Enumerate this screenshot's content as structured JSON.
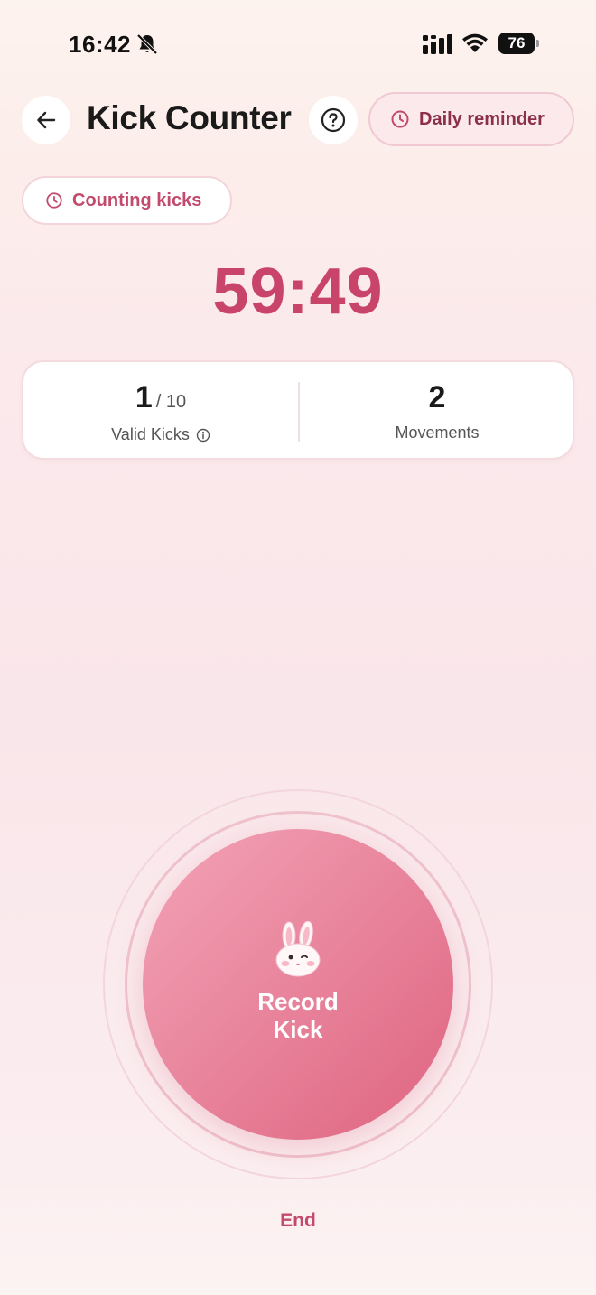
{
  "status_bar": {
    "time": "16:42",
    "battery_percent": "76",
    "icons": [
      "bell-off-icon",
      "cellular-signal-icon",
      "wifi-icon",
      "battery-icon"
    ]
  },
  "header": {
    "title": "Kick Counter",
    "back_icon": "arrow-left-icon",
    "help_icon": "question-circle-icon",
    "reminder_label": "Daily reminder",
    "reminder_icon": "clock-icon"
  },
  "session": {
    "status_label": "Counting kicks",
    "status_icon": "clock-icon",
    "timer": "59:49"
  },
  "stats": {
    "valid_kicks_value": "1",
    "valid_kicks_goal": "/ 10",
    "valid_kicks_label": "Valid Kicks",
    "movements_value": "2",
    "movements_label": "Movements"
  },
  "record": {
    "label": "Record Kick",
    "icon": "bunny-icon"
  },
  "end_label": "End",
  "colors": {
    "accent": "#c84468",
    "accent_dark": "#8c2f4b",
    "button_gradient_start": "#f3a3b7",
    "button_gradient_end": "#df6481",
    "background": "#fbe9ec"
  }
}
